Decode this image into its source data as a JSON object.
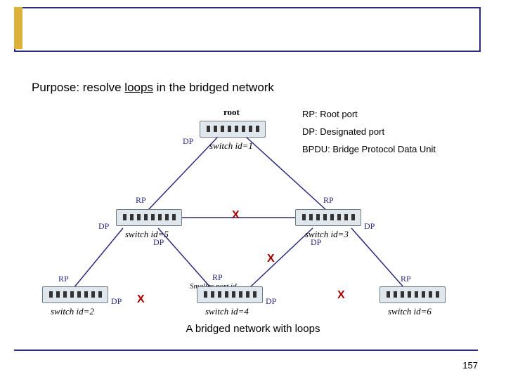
{
  "purpose_prefix": "Purpose: resolve ",
  "purpose_underlined": "loops",
  "purpose_suffix": " in the bridged network",
  "legend": {
    "rp": "RP: Root port",
    "dp": "DP: Designated port",
    "bpdu": "BPDU: Bridge Protocol Data Unit"
  },
  "labels": {
    "root": "root",
    "sw1": "switch id=1",
    "sw5": "switch id=5",
    "sw3": "switch id=3",
    "sw2": "switch id=2",
    "sw4": "switch id=4",
    "sw6": "switch id=6",
    "smaller": "Smaller port id",
    "dp": "DP",
    "rp": "RP"
  },
  "x": "X",
  "caption": "A bridged network with loops",
  "page": "157"
}
